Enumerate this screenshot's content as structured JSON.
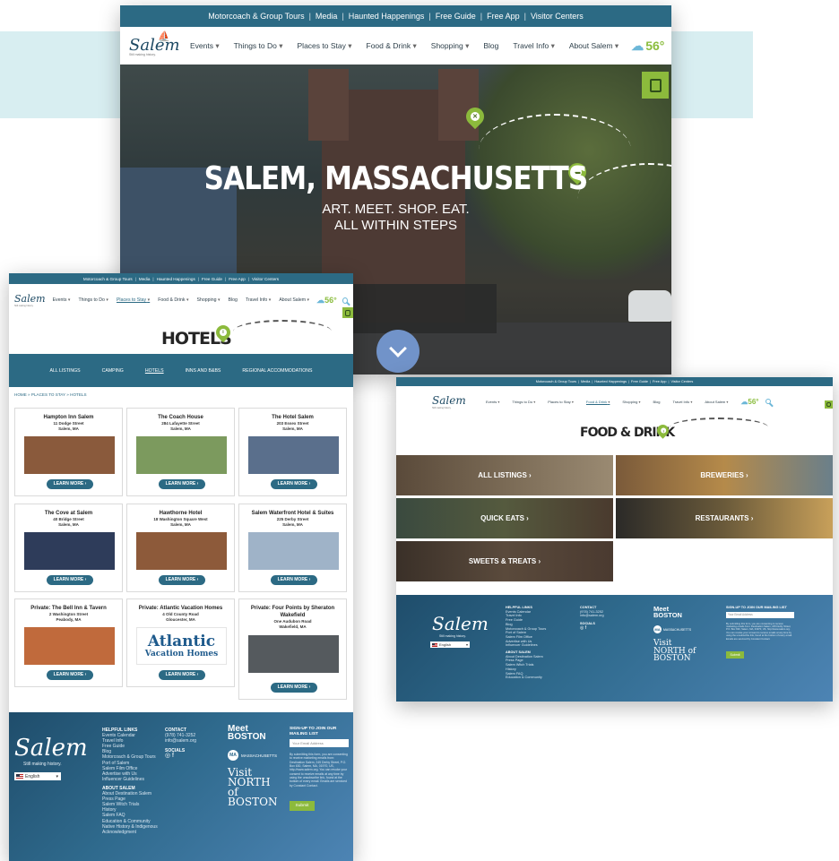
{
  "top_links": [
    "Motorcoach & Group Tours",
    "Media",
    "Haunted Happenings",
    "Free Guide",
    "Free App",
    "Visitor Centers"
  ],
  "logo": {
    "name": "Salem",
    "tagline": "Still making history."
  },
  "nav": {
    "items": [
      "Events",
      "Things to Do",
      "Places to Stay",
      "Food & Drink",
      "Shopping",
      "Blog",
      "Travel Info",
      "About Salem"
    ],
    "chev": "▾",
    "temperature": "56°"
  },
  "hero": {
    "title": "SALEM, MASSACHUSETTS",
    "line1": "ART. MEET. SHOP. EAT.",
    "line2": "ALL WITHIN STEPS"
  },
  "hotels": {
    "heading": "HOTELS",
    "subnav": [
      "ALL LISTINGS",
      "CAMPING",
      "HOTELS",
      "INNS AND B&BS",
      "REGIONAL ACCOMMODATIONS"
    ],
    "breadcrumb": "HOME » PLACES TO STAY » HOTELS",
    "learn_more": "LEARN MORE ›",
    "cards": [
      {
        "name": "Hampton Inn Salem",
        "street": "11 Dodge Street",
        "city": "Salem, MA",
        "color": "#8a5a3c"
      },
      {
        "name": "The Coach House",
        "street": "284 Lafayette Street",
        "city": "Salem, MA",
        "color": "#7c9a5e"
      },
      {
        "name": "The Hotel Salem",
        "street": "203 Essex Street",
        "city": "Salem, MA",
        "color": "#5a6f8c"
      },
      {
        "name": "The Cove at Salem",
        "street": "40 Bridge Street",
        "city": "Salem, MA",
        "color": "#2e3c5a"
      },
      {
        "name": "Hawthorne Hotel",
        "street": "18 Washington Square West",
        "city": "Salem, MA",
        "color": "#8d5a3a"
      },
      {
        "name": "Salem Waterfront Hotel & Suites",
        "street": "225 Derby Street",
        "city": "Salem, MA",
        "color": "#9fb3c8"
      },
      {
        "name": "Private: The Bell Inn & Tavern",
        "street": "2 Washington Street",
        "city": "Peabody, MA",
        "color": "#c06a3c"
      },
      {
        "name": "Private: Atlantic Vacation Homes",
        "street": "4 Old County Road",
        "city": "Gloucester, MA",
        "color": "#ffffff"
      },
      {
        "name": "Private: Four Points by Sheraton Wakefield",
        "street": "One Audubon Road",
        "city": "Wakefield, MA",
        "color": "#555a5e"
      }
    ],
    "atlantic_logo": {
      "line1": "Atlantic",
      "line2": "Vacation Homes"
    }
  },
  "footer": {
    "helpful_heading": "HELPFUL LINKS",
    "helpful_links": [
      "Events Calendar",
      "Travel Info",
      "Free Guide",
      "Blog",
      "Motorcoach & Group Tours",
      "Port of Salem",
      "Salem Film Office",
      "Advertise with Us",
      "Influencer Guidelines"
    ],
    "about_heading": "ABOUT SALEM",
    "about_links": [
      "About Destination Salem",
      "Press Page",
      "Salem Witch Trials",
      "History",
      "Salem FAQ",
      "Education & Community",
      "Native History & Indigenous",
      "Acknowledgment"
    ],
    "contact_heading": "CONTACT",
    "phone": "(978) 741-3252",
    "email": "info@salem.org",
    "socials_heading": "SOCIALS",
    "social_icons": "◎ f",
    "meet_boston": "Meet BOSTON",
    "mass_label": "MASSACHUSETTS",
    "visit_north": "Visit NORTH of BOSTON",
    "signup_heading": "SIGN-UP TO JOIN OUR MAILING LIST",
    "email_placeholder": "Your Email Address",
    "consent": "By submitting this form, you are consenting to receive marketing emails from: Destination Salem, 245 Derby Street, P.O. Box 630, Salem, MA, 01970, US, http://www.salem.org. You can revoke your consent to receive emails at any time by using the unsubscribe link, found at the bottom of every email. Emails are serviced by Constant Contact.",
    "submit": "Submit",
    "language": "English"
  },
  "food": {
    "heading": "FOOD & DRINK",
    "tiles": [
      "ALL LISTINGS ›",
      "BREWERIES ›",
      "QUICK EATS ›",
      "RESTAURANTS ›",
      "SWEETS & TREATS ›"
    ]
  }
}
